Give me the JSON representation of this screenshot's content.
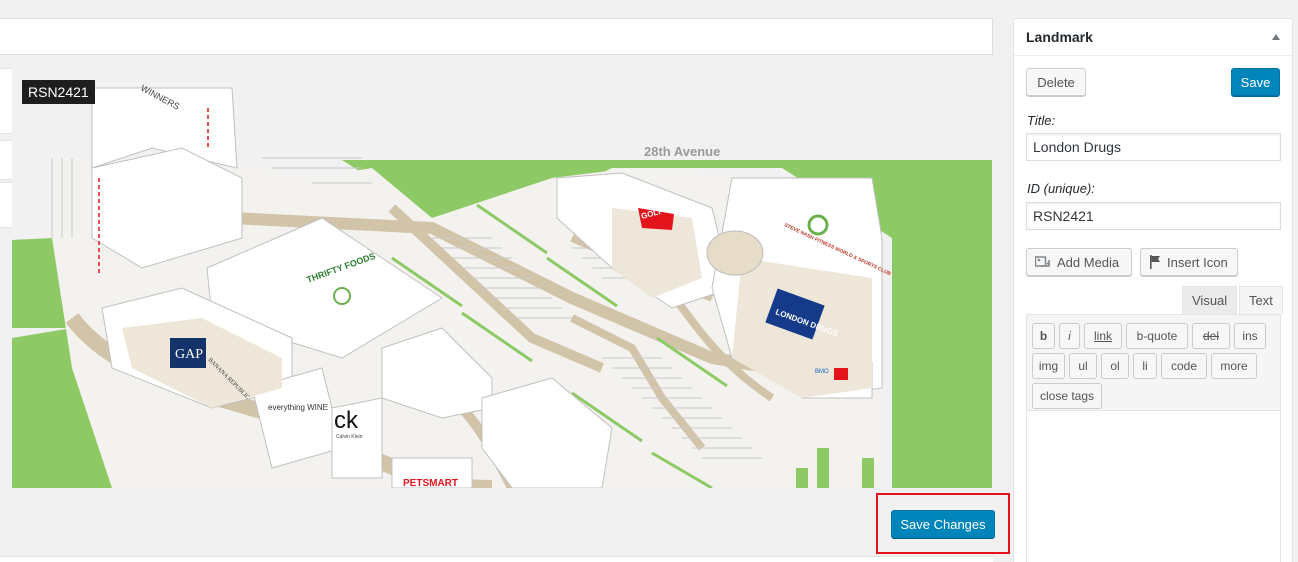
{
  "map": {
    "selected_tag": "RSN2421",
    "labels": {
      "street": "28th Avenue",
      "winners": "WINNERS",
      "golf": "GOLF TOWN",
      "steve_nash": "STEVE NASH FITNESS WORLD & SPORTS CLUB",
      "london_drugs": "LONDON DRUGS",
      "thrifty": "THRIFTY FOODS",
      "gap": "GAP",
      "banana": "BANANA REPUBLIC",
      "everything_wine": "everything WINE",
      "ck": "ck",
      "ck_sub": "Calvin Klein",
      "petsmart": "PETSMART",
      "bmo": "BMO"
    }
  },
  "footer": {
    "save_changes": "Save Changes"
  },
  "sidebar": {
    "title": "Landmark",
    "delete": "Delete",
    "save": "Save",
    "title_label": "Title:",
    "title_value": "London Drugs",
    "id_label": "ID (unique):",
    "id_value": "RSN2421",
    "add_media": "Add Media",
    "insert_icon": "Insert Icon",
    "tabs": [
      "Visual",
      "Text"
    ],
    "quicktags": [
      "b",
      "i",
      "link",
      "b-quote",
      "del",
      "ins",
      "img",
      "ul",
      "ol",
      "li",
      "code",
      "more",
      "close tags"
    ]
  },
  "colors": {
    "accent": "#0085ba",
    "highlight": "#e3141b",
    "grass": "#8dc965",
    "road": "#d2c4a9"
  }
}
